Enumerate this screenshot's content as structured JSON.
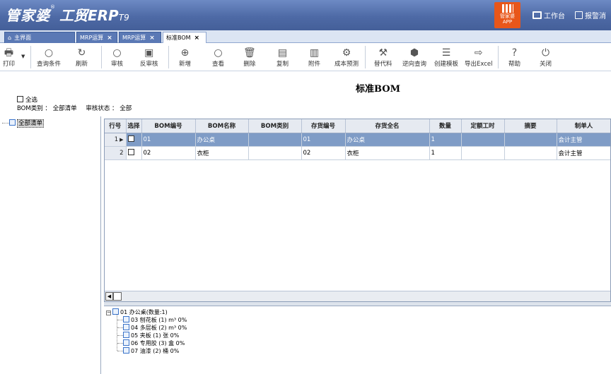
{
  "title_bar": {
    "brand": "管家婆",
    "product": "工贸ERP",
    "version": "T9",
    "app_badge": {
      "line1": "管家婆",
      "line2": "APP"
    },
    "workbench_label": "工作台",
    "report_label": "报警消"
  },
  "tabs": [
    {
      "label": "主界面",
      "icon": "home-icon"
    },
    {
      "label": "MRP运算"
    },
    {
      "label": "MRP运算"
    },
    {
      "label": "标准BOM",
      "active": true
    }
  ],
  "toolbar": {
    "print": "打印",
    "query_cond": "查询条件",
    "refresh": "刷新",
    "audit": "审核",
    "unaudit": "反审核",
    "new": "新增",
    "view": "查看",
    "delete": "删除",
    "copy": "复制",
    "attach": "附件",
    "cost_forecast": "成本预测",
    "substitute": "替代料",
    "reverse_query": "逆向查询",
    "create_template": "创建模板",
    "export_excel": "导出Excel",
    "help": "帮助",
    "close": "关闭"
  },
  "page_title": "标准BOM",
  "filters": {
    "select_all": "全选",
    "bom_type_label": "BOM类别 ：",
    "bom_type_value": "全部清单",
    "audit_status_label": "审核状态 ：",
    "audit_status_value": "全部"
  },
  "left_tree": {
    "root": "全部清单"
  },
  "grid": {
    "headers": [
      "行号",
      "选择",
      "BOM编号",
      "BOM名称",
      "BOM类别",
      "存货编号",
      "存货全名",
      "数量",
      "定额工时",
      "摘要",
      "制单人"
    ],
    "rows": [
      {
        "no": "1",
        "code": "01",
        "name": "办公桌",
        "type": "",
        "inv_code": "01",
        "inv_name": "办公桌",
        "qty": "1",
        "hours": "",
        "memo": "",
        "maker": "会计主管",
        "selected": true
      },
      {
        "no": "2",
        "code": "02",
        "name": "衣柜",
        "type": "",
        "inv_code": "02",
        "inv_name": "衣柜",
        "qty": "1",
        "hours": "",
        "memo": "",
        "maker": "会计主管",
        "selected": false
      }
    ]
  },
  "bom_tree": {
    "root": "01 办公桌(数量:1)",
    "children": [
      "03 刨花板 (1) m³ 0%",
      "04 多层板 (2) m³ 0%",
      "05 夹板 (1) 张 0%",
      "06 专用胶 (3) 盒 0%",
      "07 油漆 (2) 桶 0%"
    ]
  }
}
